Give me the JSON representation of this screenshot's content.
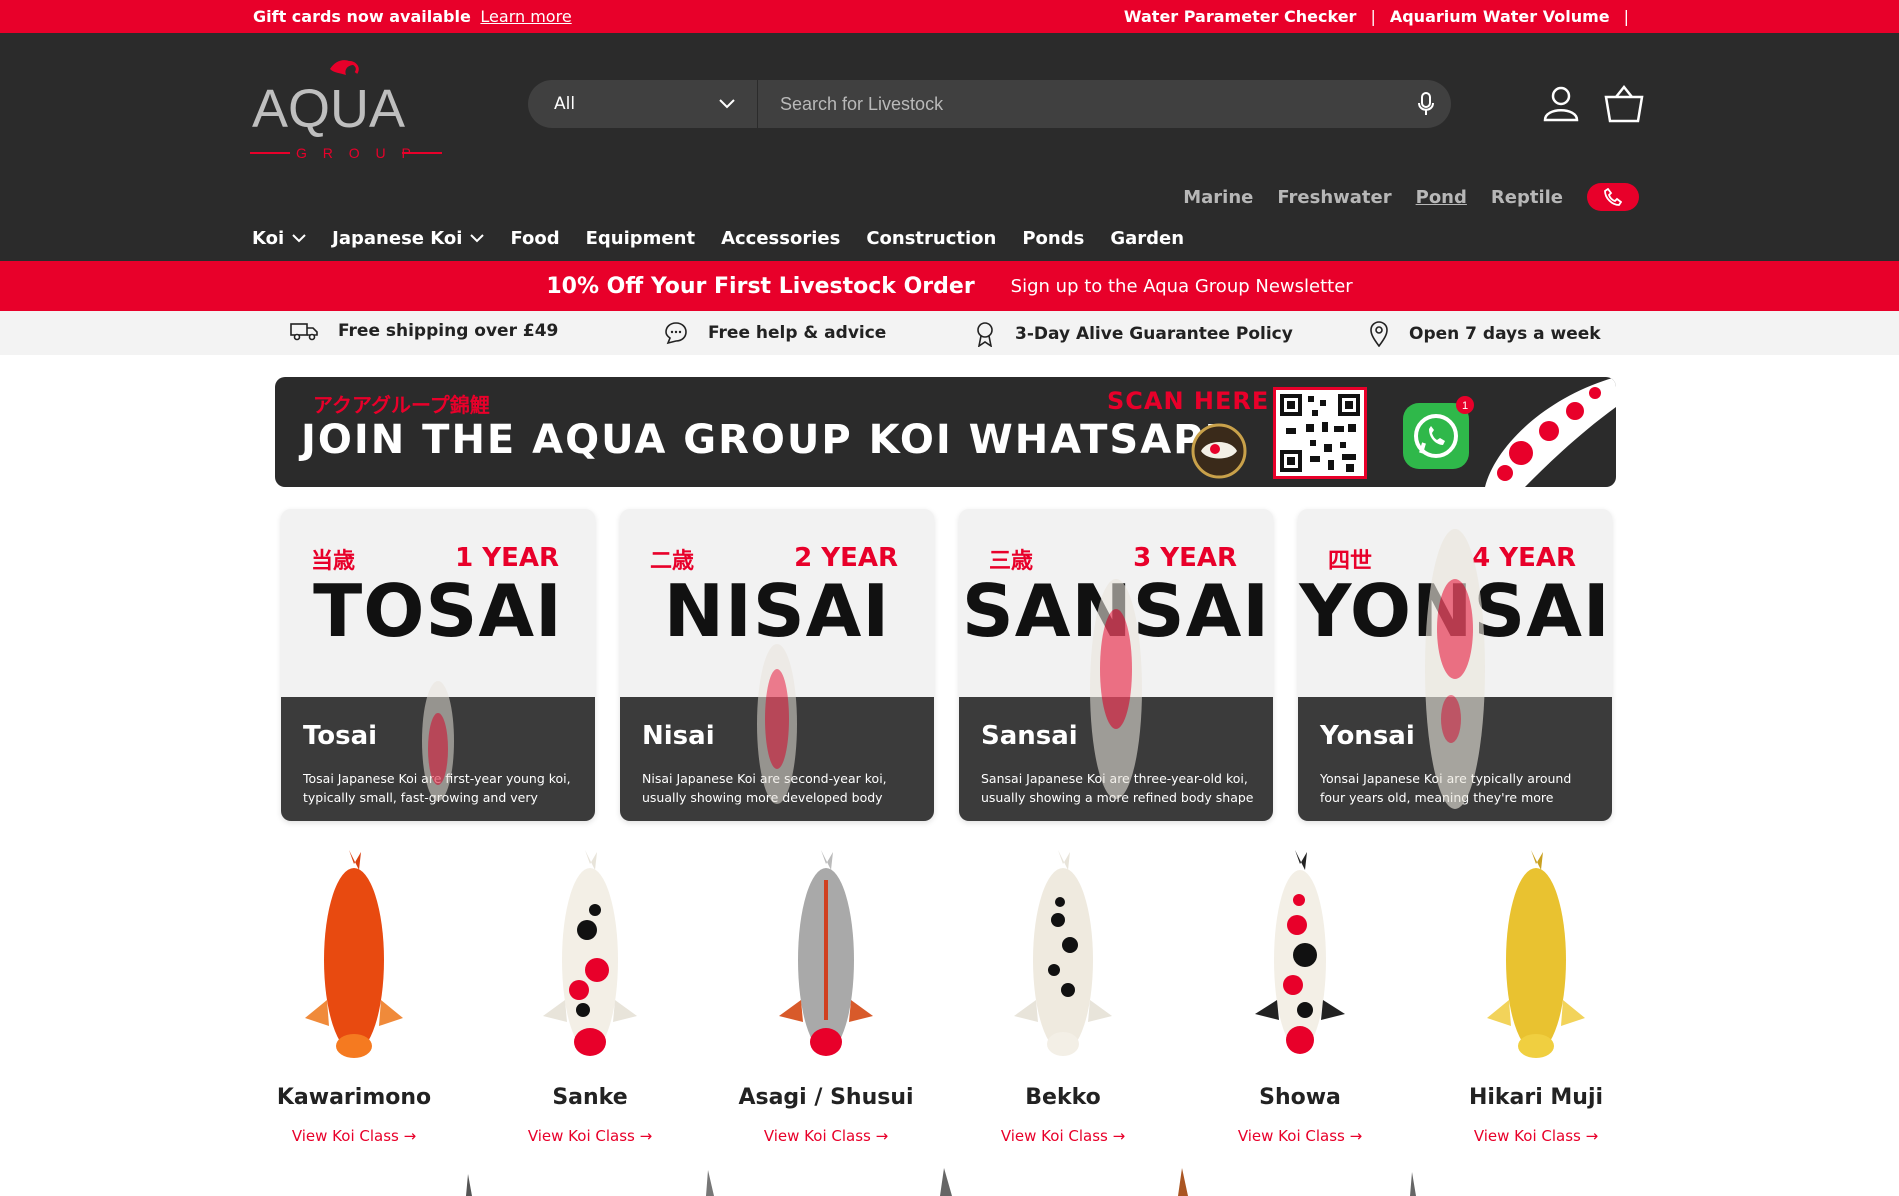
{
  "topbar": {
    "gift_text": "Gift cards now available",
    "learn_more": "Learn more",
    "link1": "Water Parameter Checker",
    "link2": "Aquarium Water Volume",
    "sep": "|"
  },
  "header": {
    "search_category": "All",
    "search_placeholder": "Search for Livestock",
    "sections": [
      "Marine",
      "Freshwater",
      "Pond",
      "Reptile"
    ],
    "active_section": "Pond",
    "nav": [
      "Koi",
      "Japanese Koi",
      "Food",
      "Equipment",
      "Accessories",
      "Construction",
      "Ponds",
      "Garden"
    ]
  },
  "logo": {
    "text": "AQUA",
    "sub": "G R O U P"
  },
  "promo": {
    "headline": "10% Off Your First Livestock Order",
    "sub": "Sign up to the Aqua Group Newsletter"
  },
  "usp": [
    {
      "icon": "truck-icon",
      "label": "Free shipping over £49"
    },
    {
      "icon": "chat-icon",
      "label": "Free help & advice"
    },
    {
      "icon": "award-icon",
      "label": "3-Day Alive Guarantee Policy"
    },
    {
      "icon": "location-pin-icon",
      "label": "Open 7 days a week"
    }
  ],
  "whatsapp_banner": {
    "jp_text": "アクアグループ錦鯉",
    "title": "JOIN THE AQUA GROUP KOI WHATSAPP",
    "scan": "SCAN HERE",
    "notification_count": "1"
  },
  "age_cards": [
    {
      "kanji": "当歳",
      "year": "1 YEAR",
      "word": "TOSAI",
      "name": "Tosai",
      "desc": "Tosai Japanese Koi are first-year young koi, typically small, fast-growing and very"
    },
    {
      "kanji": "二歳",
      "year": "2 YEAR",
      "word": "NISAI",
      "name": "Nisai",
      "desc": "Nisai Japanese Koi are second-year koi, usually showing more developed body"
    },
    {
      "kanji": "三歳",
      "year": "3 YEAR",
      "word": "SANSAI",
      "name": "Sansai",
      "desc": "Sansai Japanese Koi are three-year-old koi, usually showing a more refined body shape"
    },
    {
      "kanji": "四世",
      "year": "4 YEAR",
      "word": "YONSAI",
      "name": "Yonsai",
      "desc": "Yonsai Japanese Koi are typically around four years old, meaning they're more"
    }
  ],
  "varieties": [
    {
      "name": "Kawarimono",
      "link": "View Koi Class →"
    },
    {
      "name": "Sanke",
      "link": "View Koi Class →"
    },
    {
      "name": "Asagi / Shusui",
      "link": "View Koi Class →"
    },
    {
      "name": "Bekko",
      "link": "View Koi Class →"
    },
    {
      "name": "Showa",
      "link": "View Koi Class →"
    },
    {
      "name": "Hikari Muji",
      "link": "View Koi Class →"
    }
  ],
  "colors": {
    "brand_red": "#e8002a",
    "header_dark": "#2b2b2b",
    "card_dark": "#3b3b3b"
  }
}
